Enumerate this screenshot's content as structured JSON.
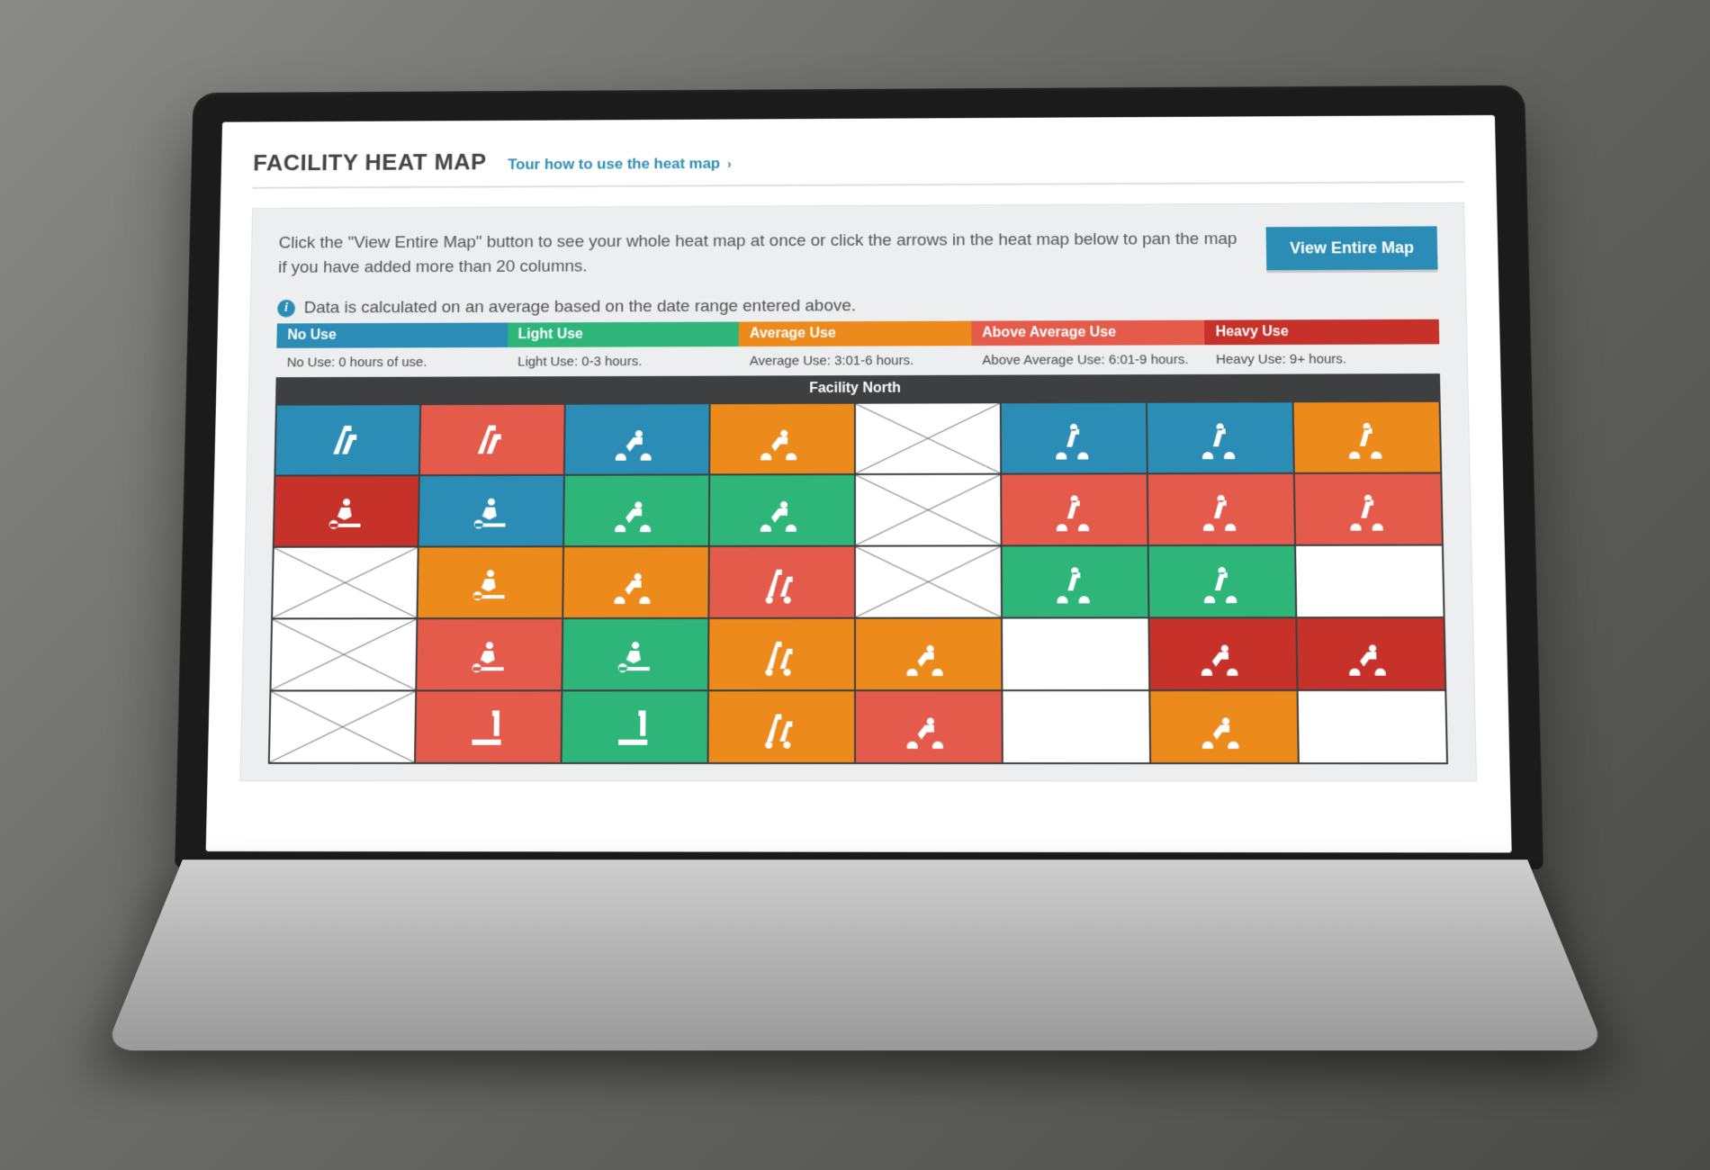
{
  "header": {
    "title": "FACILITY HEAT MAP",
    "tour_link": "Tour how to use the heat map"
  },
  "panel": {
    "instructions": "Click the \"View Entire Map\" button to see your whole heat map at once or click the arrows in the heat map below to pan the map if you have added more than 20 columns.",
    "view_map_label": "View Entire Map",
    "info_text": "Data is calculated on an average based on the date range entered above."
  },
  "legend": [
    {
      "key": "nouse",
      "label": "No Use",
      "desc": "No Use:  0 hours of use."
    },
    {
      "key": "light",
      "label": "Light Use",
      "desc": "Light Use: 0-3 hours."
    },
    {
      "key": "avg",
      "label": "Average Use",
      "desc": "Average Use: 3:01-6 hours."
    },
    {
      "key": "above",
      "label": "Above Average Use",
      "desc": "Above Average Use: 6:01-9 hours."
    },
    {
      "key": "heavy",
      "label": "Heavy Use",
      "desc": "Heavy Use: 9+ hours."
    }
  ],
  "map": {
    "title": "Facility North",
    "rows": [
      [
        {
          "use": "nouse",
          "icon": "stepper"
        },
        {
          "use": "above",
          "icon": "stepper"
        },
        {
          "use": "nouse",
          "icon": "recumbent"
        },
        {
          "use": "avg",
          "icon": "recumbent"
        },
        {
          "use": "empty"
        },
        {
          "use": "nouse",
          "icon": "upright-bike"
        },
        {
          "use": "nouse",
          "icon": "upright-bike"
        },
        {
          "use": "avg",
          "icon": "upright-bike"
        }
      ],
      [
        {
          "use": "heavy",
          "icon": "rower"
        },
        {
          "use": "nouse",
          "icon": "rower"
        },
        {
          "use": "light",
          "icon": "recumbent"
        },
        {
          "use": "light",
          "icon": "recumbent"
        },
        {
          "use": "empty"
        },
        {
          "use": "above",
          "icon": "upright-bike"
        },
        {
          "use": "above",
          "icon": "upright-bike"
        },
        {
          "use": "above",
          "icon": "upright-bike"
        }
      ],
      [
        {
          "use": "empty"
        },
        {
          "use": "avg",
          "icon": "rower"
        },
        {
          "use": "avg",
          "icon": "recumbent"
        },
        {
          "use": "above",
          "icon": "elliptical"
        },
        {
          "use": "empty"
        },
        {
          "use": "light",
          "icon": "upright-bike"
        },
        {
          "use": "light",
          "icon": "upright-bike"
        },
        {
          "use": "blank"
        }
      ],
      [
        {
          "use": "empty"
        },
        {
          "use": "above",
          "icon": "rower"
        },
        {
          "use": "light",
          "icon": "rower"
        },
        {
          "use": "avg",
          "icon": "elliptical"
        },
        {
          "use": "avg",
          "icon": "recumbent"
        },
        {
          "use": "blank"
        },
        {
          "use": "heavy",
          "icon": "recumbent"
        },
        {
          "use": "heavy",
          "icon": "recumbent"
        }
      ],
      [
        {
          "use": "empty"
        },
        {
          "use": "above",
          "icon": "treadmill"
        },
        {
          "use": "light",
          "icon": "treadmill"
        },
        {
          "use": "avg",
          "icon": "elliptical"
        },
        {
          "use": "above",
          "icon": "recumbent"
        },
        {
          "use": "blank"
        },
        {
          "use": "avg",
          "icon": "recumbent"
        },
        {
          "use": "blank"
        }
      ]
    ]
  },
  "colors": {
    "nouse": "#2b8db6",
    "light": "#2db57a",
    "avg": "#ec8a1b",
    "above": "#e55b4b",
    "heavy": "#c63129"
  }
}
